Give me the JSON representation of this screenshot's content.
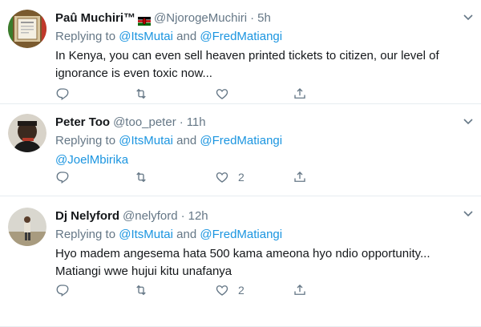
{
  "tweets": [
    {
      "name": "Paû Muchiri™",
      "handle": "@NjorogeMuchiri",
      "dot": "·",
      "time": "5h",
      "replying_prefix": "Replying to ",
      "reply_user1": "@ItsMutai",
      "reply_and": " and ",
      "reply_user2": "@FredMatiangi",
      "text_line1": "In Kenya, you can even sell heaven printed tickets to citizen, our level of",
      "text_line2": "ignorance is even toxic now...",
      "like_count": ""
    },
    {
      "name": "Peter Too",
      "handle": "@too_peter",
      "dot": "·",
      "time": "11h",
      "replying_prefix": "Replying to ",
      "reply_user1": "@ItsMutai",
      "reply_and": " and ",
      "reply_user2": "@FredMatiangi",
      "text_line1": "@JoelMbirika",
      "text_line2": "",
      "like_count": "2"
    },
    {
      "name": "Dj Nelyford",
      "handle": "@nelyford",
      "dot": "·",
      "time": "12h",
      "replying_prefix": "Replying to ",
      "reply_user1": "@ItsMutai",
      "reply_and": " and ",
      "reply_user2": "@FredMatiangi",
      "text_line1": "Hyo madem angesema hata 500 kama ameona hyo ndio opportunity...",
      "text_line2": "Matiangi wwe hujui kitu unafanya",
      "like_count": "2"
    }
  ],
  "icons": {
    "reply": "reply-icon",
    "retweet": "retweet-icon",
    "like": "heart-icon",
    "share": "share-icon",
    "caret": "chevron-down-icon"
  },
  "colors": {
    "link": "#1b95e0",
    "muted": "#657786",
    "divider": "#e6ecf0"
  }
}
